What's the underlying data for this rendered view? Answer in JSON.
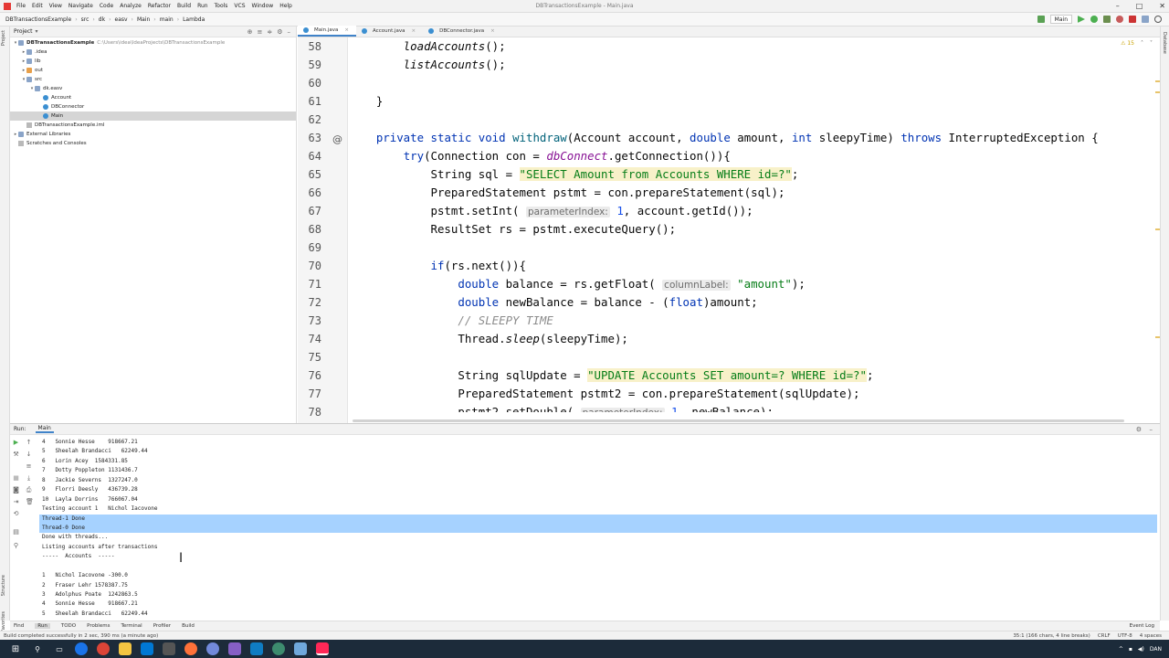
{
  "titlebar": {
    "menus": [
      "File",
      "Edit",
      "View",
      "Navigate",
      "Code",
      "Analyze",
      "Refactor",
      "Build",
      "Run",
      "Tools",
      "VCS",
      "Window",
      "Help"
    ],
    "window_title": "DBTransactionsExample - Main.java"
  },
  "navbar": {
    "crumbs": [
      "DBTransactionsExample",
      "src",
      "dk",
      "easv",
      "Main",
      "main",
      "Lambda"
    ],
    "run_config": "Main"
  },
  "leftstripe": {
    "project_label": "Project",
    "structure_label": "Structure",
    "favorites_label": "Favorites"
  },
  "rightstripe": {
    "database_label": "Database"
  },
  "project": {
    "header": "Project",
    "tree": [
      {
        "label": "DBTransactionsExample",
        "path": "C:\\Users\\idea\\IdeaProjects\\DBTransactionsExample",
        "indent": 0,
        "arrow": "▾",
        "icon": "folder",
        "bold": true
      },
      {
        "label": ".idea",
        "indent": 1,
        "arrow": "▸",
        "icon": "folder"
      },
      {
        "label": "lib",
        "indent": 1,
        "arrow": "▸",
        "icon": "folder"
      },
      {
        "label": "out",
        "indent": 1,
        "arrow": "▸",
        "icon": "ofolder"
      },
      {
        "label": "src",
        "indent": 1,
        "arrow": "▾",
        "icon": "folder"
      },
      {
        "label": "dk.easv",
        "indent": 2,
        "arrow": "▾",
        "icon": "folder"
      },
      {
        "label": "Account",
        "indent": 3,
        "arrow": "",
        "icon": "cls"
      },
      {
        "label": "DBConnector",
        "indent": 3,
        "arrow": "",
        "icon": "cls"
      },
      {
        "label": "Main",
        "indent": 3,
        "arrow": "",
        "icon": "cls",
        "selected": true
      },
      {
        "label": "DBTransactionsExample.iml",
        "indent": 1,
        "arrow": "",
        "icon": "file"
      },
      {
        "label": "External Libraries",
        "indent": 0,
        "arrow": "▸",
        "icon": "folder"
      },
      {
        "label": "Scratches and Consoles",
        "indent": 0,
        "arrow": "",
        "icon": "file"
      }
    ]
  },
  "editor": {
    "tabs": [
      {
        "label": "Main.java",
        "active": true
      },
      {
        "label": "Account.java",
        "active": false
      },
      {
        "label": "DBConnector.java",
        "active": false
      }
    ],
    "inspection_count": "15",
    "line_numbers": [
      "58",
      "59",
      "60",
      "61",
      "62",
      "63",
      "64",
      "65",
      "66",
      "67",
      "68",
      "69",
      "70",
      "71",
      "72",
      "73",
      "74",
      "75",
      "76",
      "77",
      "78"
    ]
  },
  "run": {
    "label": "Run:",
    "tab": "Main",
    "console": [
      "4   Sonnie Hesse    918667.21",
      "5   Sheelah Brandacci   62249.44",
      "6   Lorin Acey  1584331.85",
      "7   Dotty Poppleton 1131436.7",
      "8   Jackie Severns  1327247.0",
      "9   Florri Deesly   436739.28",
      "10  Layla Dorrins   766067.04",
      "Testing account 1   Nichol Iacovone",
      "Thread-1 Done",
      "Thread-0 Done",
      "Done with threads...",
      "Listing accounts after transactions",
      "-----  Accounts  -----",
      "",
      "1   Nichol Iacovone -300.0",
      "2   Fraser Lehr 1578387.75",
      "3   Adolphus Poate  1242863.5",
      "4   Sonnie Hesse    918667.21",
      "5   Sheelah Brandacci   62249.44"
    ],
    "selected_lines": [
      8,
      9
    ]
  },
  "bottomtabs": {
    "tabs": [
      "Find",
      "Run",
      "TODO",
      "Problems",
      "Terminal",
      "Profiler",
      "Build"
    ],
    "active": "Run",
    "event_log": "Event Log"
  },
  "statusbar": {
    "message": "Build completed successfully in 2 sec, 390 ms (a minute ago)",
    "right": [
      "35:1 (166 chars, 4 line breaks)",
      "CRLF",
      "UTF-8",
      "4 spaces"
    ]
  },
  "taskbar": {
    "tray_lang": "DAN"
  }
}
